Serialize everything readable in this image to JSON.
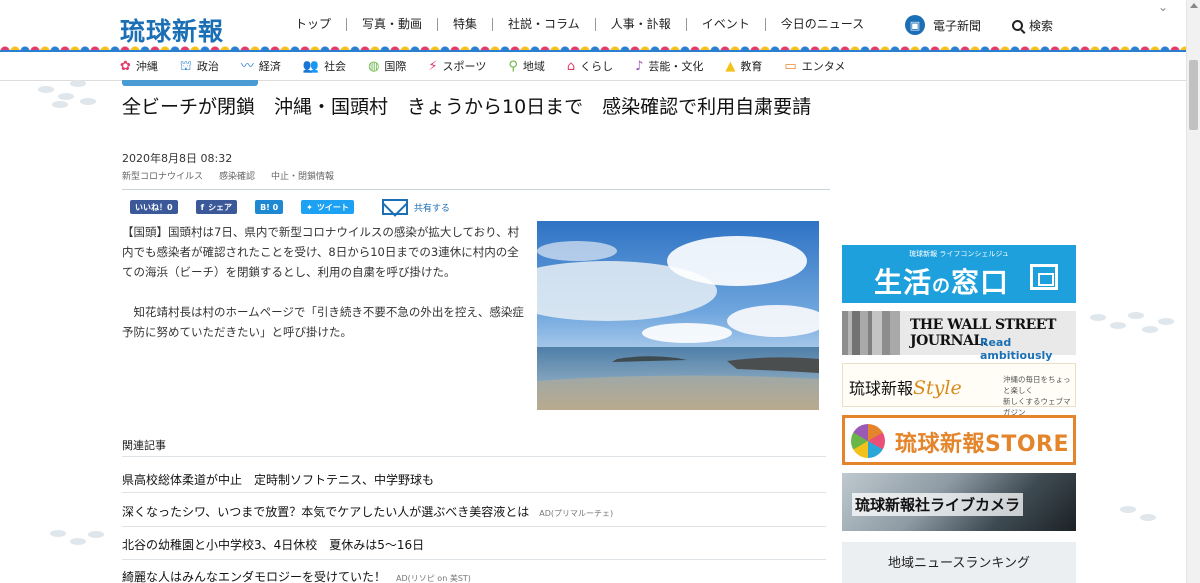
{
  "header": {
    "logo": "琉球新報",
    "nav": [
      "トップ",
      "写真・動画",
      "特集",
      "社説・コラム",
      "人事・訃報",
      "イベント",
      "今日のニュース"
    ],
    "denshi_label": "電子新聞",
    "search_label": "検索"
  },
  "categories": [
    {
      "icon": "hibiscus-icon",
      "glyph": "✿",
      "label": "沖縄",
      "color": "#e23b6a"
    },
    {
      "icon": "parliament-icon",
      "glyph": "⛫",
      "label": "政治",
      "color": "#2b7fd0"
    },
    {
      "icon": "chart-icon",
      "glyph": "〰",
      "label": "経済",
      "color": "#2b7fd0"
    },
    {
      "icon": "people-icon",
      "glyph": "👥",
      "label": "社会",
      "color": "#2b7fd0"
    },
    {
      "icon": "globe-icon",
      "glyph": "◍",
      "label": "国際",
      "color": "#6ab547"
    },
    {
      "icon": "runner-icon",
      "glyph": "⚡",
      "label": "スポーツ",
      "color": "#e23b6a"
    },
    {
      "icon": "pin-icon",
      "glyph": "⚲",
      "label": "地域",
      "color": "#6ab547"
    },
    {
      "icon": "home-icon",
      "glyph": "⌂",
      "label": "くらし",
      "color": "#e23b6a"
    },
    {
      "icon": "music-icon",
      "glyph": "♪",
      "label": "芸能・文化",
      "color": "#9a59b5"
    },
    {
      "icon": "graduation-icon",
      "glyph": "▲",
      "label": "教育",
      "color": "#f2c21b"
    },
    {
      "icon": "tv-icon",
      "glyph": "▭",
      "label": "エンタメ",
      "color": "#e4852b"
    }
  ],
  "article": {
    "title": "全ビーチが閉鎖　沖縄・国頭村　きょうから10日まで　感染確認で利用自粛要請",
    "date": "2020年8月8日 08:32",
    "tags": [
      "新型コロナウイルス",
      "感染確認",
      "中止・閉鎖情報"
    ],
    "paragraph1": "【国頭】国頭村は7日、県内で新型コロナウイルスの感染が拡大しており、村内でも感染者が確認されたことを受け、8日から10日までの3連休に村内の全ての海浜（ビーチ）を閉鎖するとし、利用の自粛を呼び掛けた。",
    "paragraph2": "　知花靖村長は村のホームページで「引き続き不要不急の外出を控え、感染症予防に努めていただきたい」と呼び掛けた。"
  },
  "share": {
    "like": "いいね！0",
    "share": "シェア",
    "hatena": "B! 0",
    "tweet": "ツイート",
    "mail": "共有する"
  },
  "related": {
    "heading": "関連記事",
    "items": [
      {
        "title": "県高校総体柔道が中止　定時制ソフトテニス、中学野球も",
        "ad": ""
      },
      {
        "title": "深くなったシワ、いつまで放置？本気でケアしたい人が選ぶべき美容液とは",
        "ad": "AD(プリマルーチェ)"
      },
      {
        "title": "北谷の幼稚園と小中学校3、4日休校　夏休みは5～16日",
        "ad": ""
      },
      {
        "title": "綺麗な人はみんなエンダモロジーを受けていた！",
        "ad": "AD(リソピ on 美ST)"
      }
    ]
  },
  "sidebar": {
    "kurashi_small": "琉球新報 ライフコンシェルジュ",
    "kurashi_big1": "生活",
    "kurashi_no": "の",
    "kurashi_big2": "窓口",
    "wsj_title": "THE WALL STREET JOURNAL.",
    "wsj_sub": "Read ambitiously",
    "style_name": "琉球新報",
    "style_word": "Style",
    "style_line1": "沖縄の毎日をちょっと楽しく",
    "style_line2": "新しくするウェブマガジン",
    "store": "琉球新報STORE",
    "camera": "琉球新報社ライブカメラ",
    "ranking": "地域ニュースランキング"
  }
}
